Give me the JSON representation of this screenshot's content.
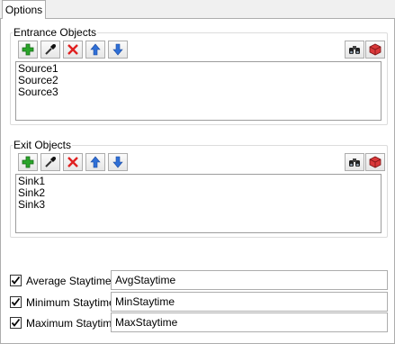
{
  "tab": {
    "label": "Options"
  },
  "entrance": {
    "title": "Entrance Objects",
    "items": [
      "Source1",
      "Source2",
      "Source3"
    ]
  },
  "exit": {
    "title": "Exit Objects",
    "items": [
      "Sink1",
      "Sink2",
      "Sink3"
    ]
  },
  "staytimes": [
    {
      "label": "Average Staytime",
      "checked": true,
      "value": "AvgStaytime"
    },
    {
      "label": "Minimum Staytime",
      "checked": true,
      "value": "MinStaytime"
    },
    {
      "label": "Maximum Staytime",
      "checked": true,
      "value": "MaxStaytime"
    }
  ],
  "toolbar_icons": [
    "plus-icon",
    "eyedropper-icon",
    "delete-x-icon",
    "arrow-up-icon",
    "arrow-down-icon",
    "binoculars-icon",
    "cube-icon"
  ],
  "colors": {
    "plus": "#2aa52a",
    "delete": "#e02020",
    "arrow": "#2f6fd6",
    "cube": "#d9383a"
  }
}
